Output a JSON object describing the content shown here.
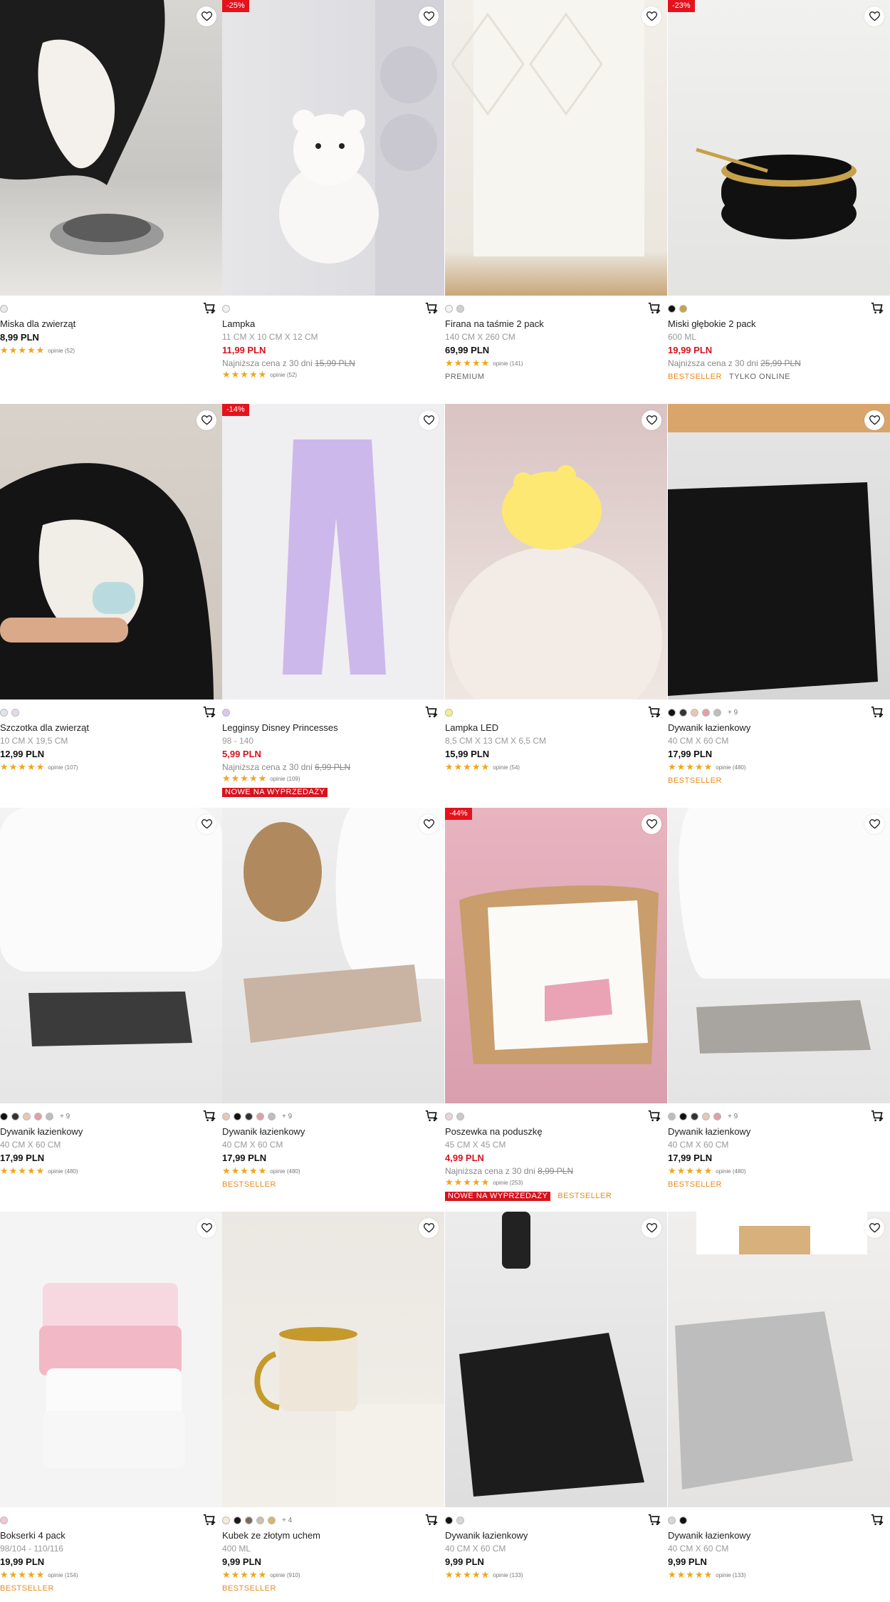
{
  "colors": {
    "sale_red": "#d8121e",
    "bestseller": "#e58b1e",
    "star": "#f0a51c"
  },
  "products": [
    {
      "name": "Miska dla zwierząt",
      "size": "",
      "price": "8,99 PLN",
      "price_sale": false,
      "lowest_label": "",
      "lowest_old": "",
      "rating": "opinie (52)",
      "discount": "",
      "swatches": [
        "#e9e9e9"
      ],
      "more": "",
      "tags": []
    },
    {
      "name": "Lampka",
      "size": "11 CM X 10 CM X 12 CM",
      "price": "11,99 PLN",
      "price_sale": true,
      "lowest_label": "Najniższa cena z 30 dni",
      "lowest_old": "15,99 PLN",
      "rating": "opinie (52)",
      "discount": "-25%",
      "swatches": [
        "#f0f0f0"
      ],
      "more": "",
      "tags": []
    },
    {
      "name": "Firana na taśmie 2 pack",
      "size": "140 CM X 260 CM",
      "price": "69,99 PLN",
      "price_sale": false,
      "lowest_label": "",
      "lowest_old": "",
      "rating": "opinie (141)",
      "discount": "",
      "swatches": [
        "#f3f3f3",
        "#cfcfcf"
      ],
      "more": "",
      "tags": [
        "PREMIUM"
      ]
    },
    {
      "name": "Miski głębokie 2 pack",
      "size": "600 ML",
      "price": "19,99 PLN",
      "price_sale": true,
      "lowest_label": "Najniższa cena z 30 dni",
      "lowest_old": "25,99 PLN",
      "rating": "",
      "discount": "-23%",
      "swatches": [
        "#111111",
        "#c9a24a"
      ],
      "more": "",
      "tags": [
        "BESTSELLER",
        "TYLKO ONLINE"
      ]
    },
    {
      "name": "Szczotka dla zwierząt",
      "size": "10 CM X 19,5 CM",
      "price": "12,99 PLN",
      "price_sale": false,
      "lowest_label": "",
      "lowest_old": "",
      "rating": "opinie (107)",
      "discount": "",
      "swatches": [
        "#dfe4ee",
        "#e8d8ec"
      ],
      "more": "",
      "tags": []
    },
    {
      "name": "Legginsy Disney Princesses",
      "size": "98 - 140",
      "price": "5,99 PLN",
      "price_sale": true,
      "lowest_label": "Najniższa cena z 30 dni",
      "lowest_old": "6,99 PLN",
      "rating": "opinie (109)",
      "discount": "-14%",
      "swatches": [
        "#d9c8ee"
      ],
      "more": "",
      "tags": [
        "NOWE NA WYPRZEDAŻY"
      ]
    },
    {
      "name": "Lampka LED",
      "size": "8,5 CM X 13 CM X 6,5 CM",
      "price": "15,99 PLN",
      "price_sale": false,
      "lowest_label": "",
      "lowest_old": "",
      "rating": "opinie (54)",
      "discount": "",
      "swatches": [
        "#f6ee8a"
      ],
      "more": "",
      "tags": []
    },
    {
      "name": "Dywanik łazienkowy",
      "size": "40 CM X 60 CM",
      "price": "17,99 PLN",
      "price_sale": false,
      "lowest_label": "",
      "lowest_old": "",
      "rating": "opinie (480)",
      "discount": "",
      "swatches": [
        "#111111",
        "#333333",
        "#e6c8b8",
        "#e0a0a4",
        "#bdbdbd"
      ],
      "more": "+ 9",
      "tags": [
        "BESTSELLER"
      ]
    },
    {
      "name": "Dywanik łazienkowy",
      "size": "40 CM X 60 CM",
      "price": "17,99 PLN",
      "price_sale": false,
      "lowest_label": "",
      "lowest_old": "",
      "rating": "opinie (480)",
      "discount": "",
      "swatches": [
        "#111111",
        "#333333",
        "#e6c8b8",
        "#e0a0a4",
        "#bdbdbd"
      ],
      "more": "+ 9",
      "tags": []
    },
    {
      "name": "Dywanik łazienkowy",
      "size": "40 CM X 60 CM",
      "price": "17,99 PLN",
      "price_sale": false,
      "lowest_label": "",
      "lowest_old": "",
      "rating": "opinie (480)",
      "discount": "",
      "swatches": [
        "#e6c8b8",
        "#111111",
        "#333333",
        "#e0a0a4",
        "#bdbdbd"
      ],
      "more": "+ 9",
      "tags": [
        "BESTSELLER"
      ]
    },
    {
      "name": "Poszewka na poduszkę",
      "size": "45 CM X 45 CM",
      "price": "4,99 PLN",
      "price_sale": true,
      "lowest_label": "Najniższa cena z 30 dni",
      "lowest_old": "8,99 PLN",
      "rating": "opinie (253)",
      "discount": "-44%",
      "swatches": [
        "#e9d3d8",
        "#c9c9c9"
      ],
      "more": "",
      "tags": [
        "NOWE NA WYPRZEDAŻY",
        "BESTSELLER"
      ]
    },
    {
      "name": "Dywanik łazienkowy",
      "size": "40 CM X 60 CM",
      "price": "17,99 PLN",
      "price_sale": false,
      "lowest_label": "",
      "lowest_old": "",
      "rating": "opinie (480)",
      "discount": "",
      "swatches": [
        "#bdbdbd",
        "#111111",
        "#333333",
        "#e6c8b8",
        "#e0a0a4"
      ],
      "more": "+ 9",
      "tags": [
        "BESTSELLER"
      ]
    },
    {
      "name": "Bokserki 4 pack",
      "size": "98/104 - 110/116",
      "price": "19,99 PLN",
      "price_sale": false,
      "lowest_label": "",
      "lowest_old": "",
      "rating": "opinie (154)",
      "discount": "",
      "swatches": [
        "#f2c6d4"
      ],
      "more": "",
      "tags": [
        "BESTSELLER"
      ]
    },
    {
      "name": "Kubek ze złotym uchem",
      "size": "400 ML",
      "price": "9,99 PLN",
      "price_sale": false,
      "lowest_label": "",
      "lowest_old": "",
      "rating": "opinie (910)",
      "discount": "",
      "swatches": [
        "#f4ecd8",
        "#1a1a1a",
        "#7a6a5a",
        "#c9c0b0",
        "#d8b66a"
      ],
      "more": "+ 4",
      "tags": [
        "BESTSELLER"
      ]
    },
    {
      "name": "Dywanik łazienkowy",
      "size": "40 CM X 60 CM",
      "price": "9,99 PLN",
      "price_sale": false,
      "lowest_label": "",
      "lowest_old": "",
      "rating": "opinie (133)",
      "discount": "",
      "swatches": [
        "#111111",
        "#d6d6d6"
      ],
      "more": "",
      "tags": []
    },
    {
      "name": "Dywanik łazienkowy",
      "size": "40 CM X 60 CM",
      "price": "9,99 PLN",
      "price_sale": false,
      "lowest_label": "",
      "lowest_old": "",
      "rating": "opinie (133)",
      "discount": "",
      "swatches": [
        "#d6d6d6",
        "#111111"
      ],
      "more": "",
      "tags": []
    }
  ]
}
